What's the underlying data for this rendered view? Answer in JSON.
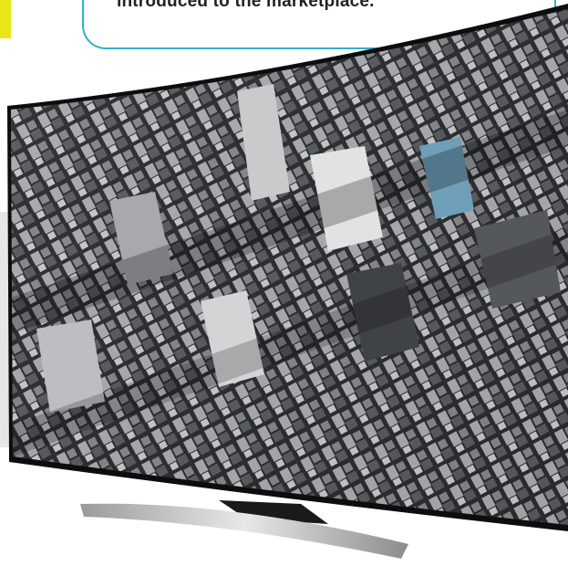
{
  "callout": {
    "text": "introduced to the marketplace.",
    "border_color": "#2fb3c6"
  },
  "accent": {
    "color": "#e8e617"
  },
  "tv": {
    "description_icon": "curved-tv-icon"
  }
}
